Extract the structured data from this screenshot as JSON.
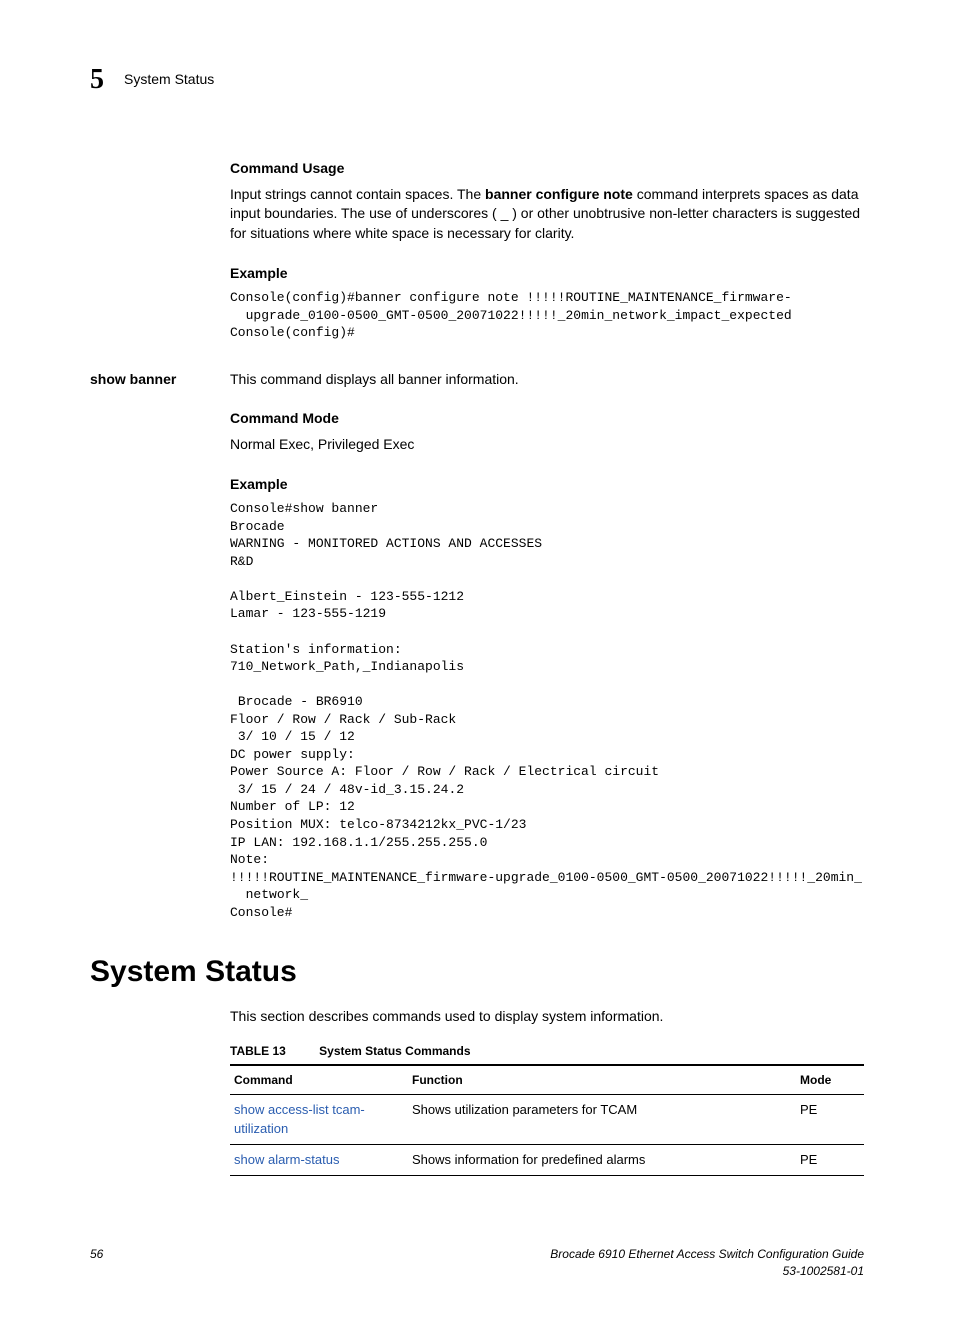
{
  "header": {
    "chapter_num": "5",
    "chapter_title": "System Status"
  },
  "section1": {
    "heading_command_usage": "Command Usage",
    "usage_para_pre": "Input strings cannot contain spaces. The ",
    "usage_para_bold": "banner configure note",
    "usage_para_post": " command interprets spaces as data input boundaries. The use of underscores ( _ ) or other unobtrusive non-letter characters is suggested for situations where white space is necessary for clarity.",
    "heading_example1": "Example",
    "example1_code": "Console(config)#banner configure note !!!!!ROUTINE_MAINTENANCE_firmware-\n  upgrade_0100-0500_GMT-0500_20071022!!!!!_20min_network_impact_expected\nConsole(config)#"
  },
  "show_banner": {
    "margin_label": "show banner",
    "desc": "This command displays all banner information.",
    "heading_mode": "Command Mode",
    "mode_text": "Normal Exec, Privileged Exec",
    "heading_example": "Example",
    "example_code": "Console#show banner\nBrocade\nWARNING - MONITORED ACTIONS AND ACCESSES\nR&D\n\nAlbert_Einstein - 123-555-1212\nLamar - 123-555-1219\n\nStation's information:\n710_Network_Path,_Indianapolis\n\n Brocade - BR6910\nFloor / Row / Rack / Sub-Rack\n 3/ 10 / 15 / 12\nDC power supply:\nPower Source A: Floor / Row / Rack / Electrical circuit\n 3/ 15 / 24 / 48v-id_3.15.24.2\nNumber of LP: 12\nPosition MUX: telco-8734212kx_PVC-1/23\nIP LAN: 192.168.1.1/255.255.255.0\nNote:\n!!!!!ROUTINE_MAINTENANCE_firmware-upgrade_0100-0500_GMT-0500_20071022!!!!!_20min_\n  network_\nConsole#"
  },
  "system_status": {
    "heading": "System Status",
    "intro": "This section describes commands used to display system information.",
    "table_label_num": "TABLE 13",
    "table_label_title": "System Status Commands",
    "columns": {
      "c0": "Command",
      "c1": "Function",
      "c2": "Mode"
    },
    "rows": [
      {
        "cmd": "show access-list tcam-utilization",
        "func": "Shows utilization parameters for TCAM",
        "mode": "PE"
      },
      {
        "cmd": "show alarm-status",
        "func": "Shows information for predefined alarms",
        "mode": "PE"
      }
    ]
  },
  "footer": {
    "page_num": "56",
    "doc_title": "Brocade 6910 Ethernet Access Switch Configuration Guide",
    "doc_id": "53-1002581-01"
  }
}
